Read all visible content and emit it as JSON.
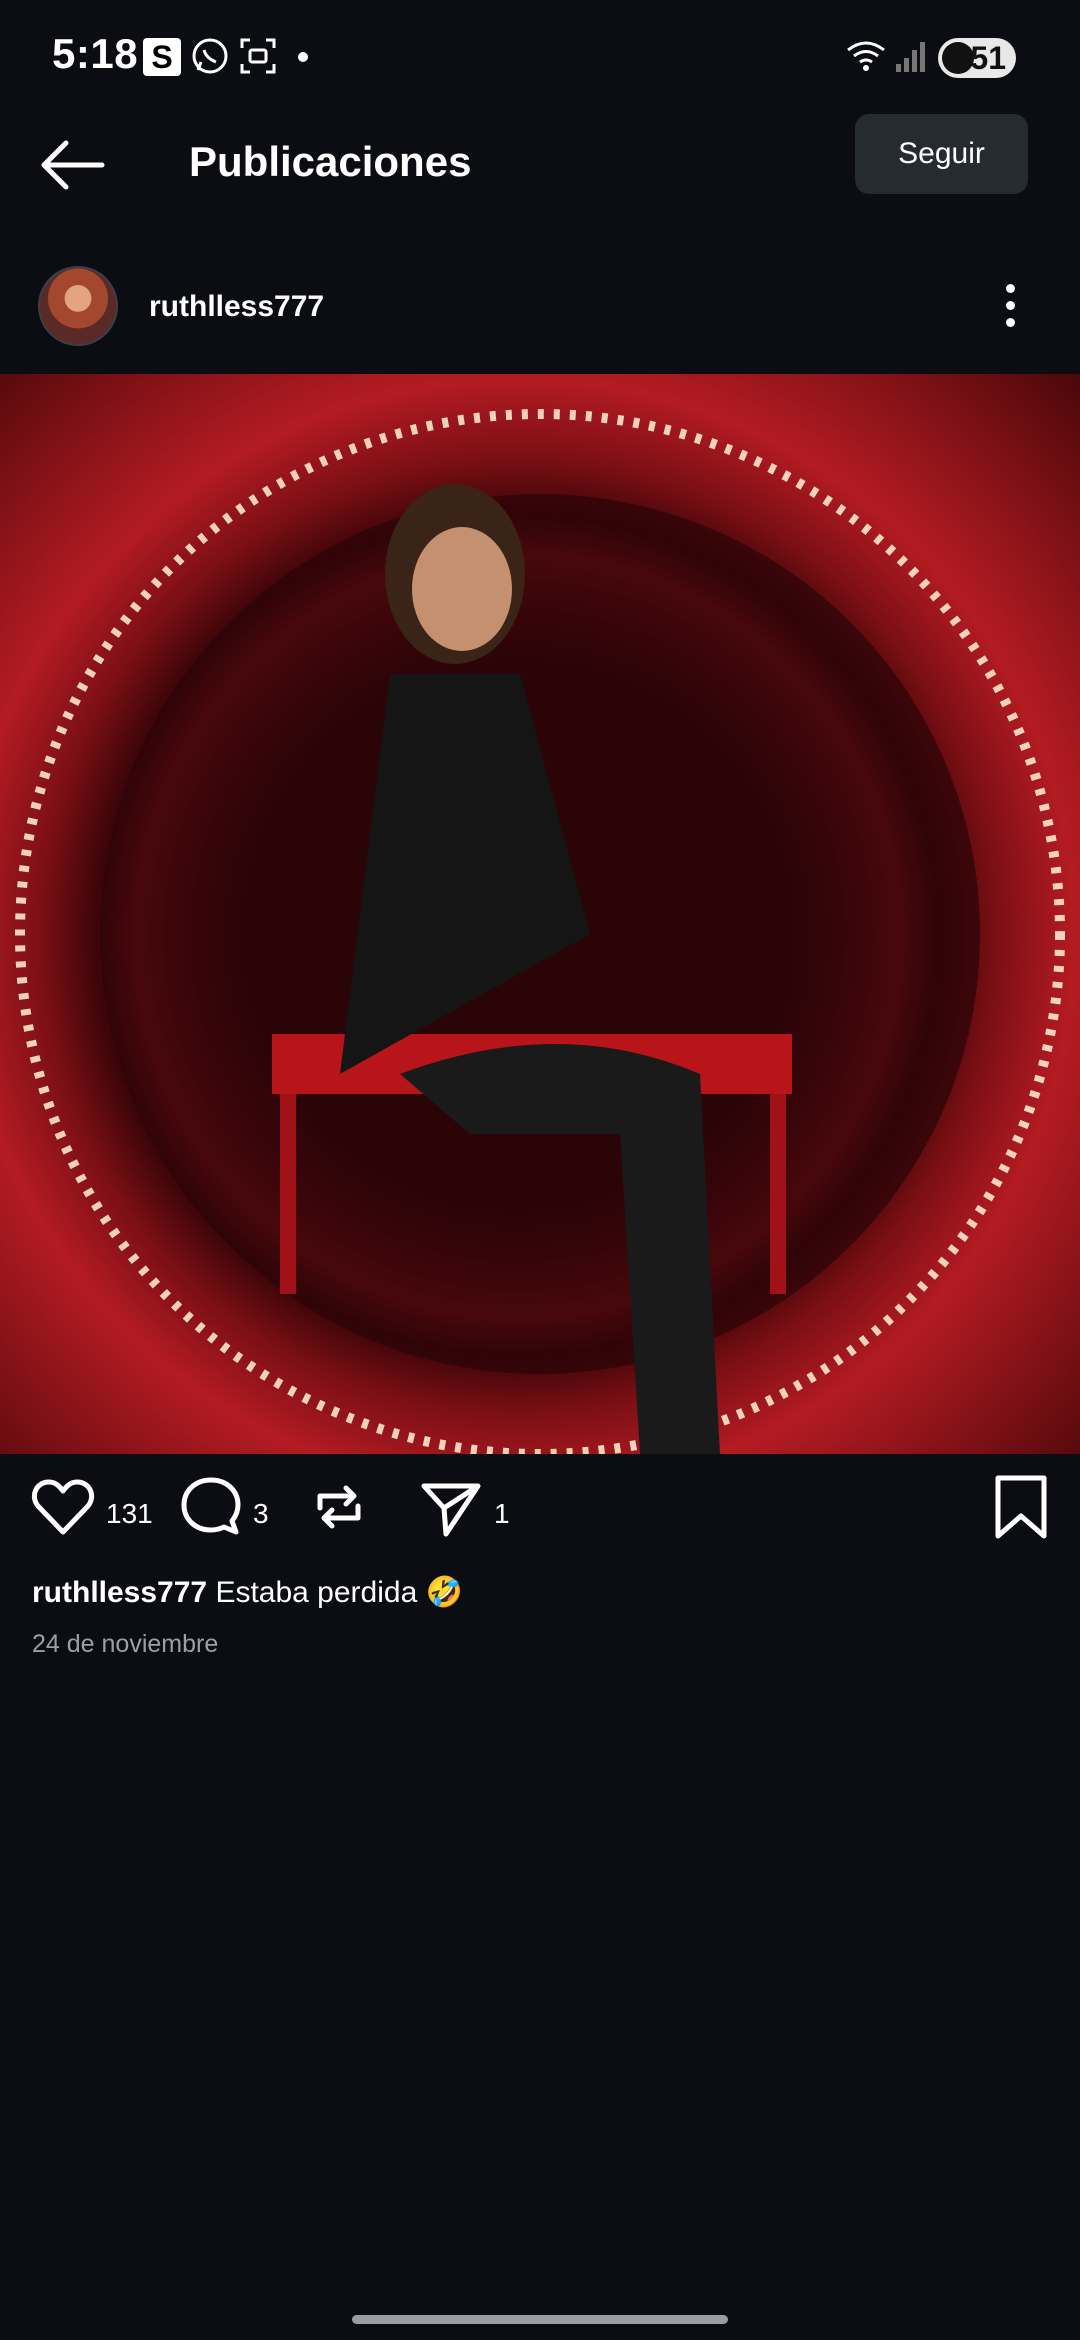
{
  "status_bar": {
    "time": "5:18",
    "app_s_letter": "S",
    "battery_level": "51"
  },
  "header": {
    "title": "Publicaciones",
    "follow_label": "Seguir"
  },
  "post": {
    "username": "ruthlless777",
    "likes": "131",
    "comments": "3",
    "shares": "1",
    "caption_username": "ruthlless777",
    "caption_text": "Estaba perdida 🤣",
    "date": "24 de noviembre"
  },
  "icons": {
    "back": "arrow-left-icon",
    "more": "vertical-dots-icon",
    "like": "heart-icon",
    "comment": "speech-bubble-icon",
    "repost": "repost-icon",
    "share": "paper-plane-icon",
    "save": "bookmark-icon"
  },
  "colors": {
    "background": "#0b0d12",
    "follow_button": "#262a31",
    "date_text": "#9aa0a8"
  }
}
